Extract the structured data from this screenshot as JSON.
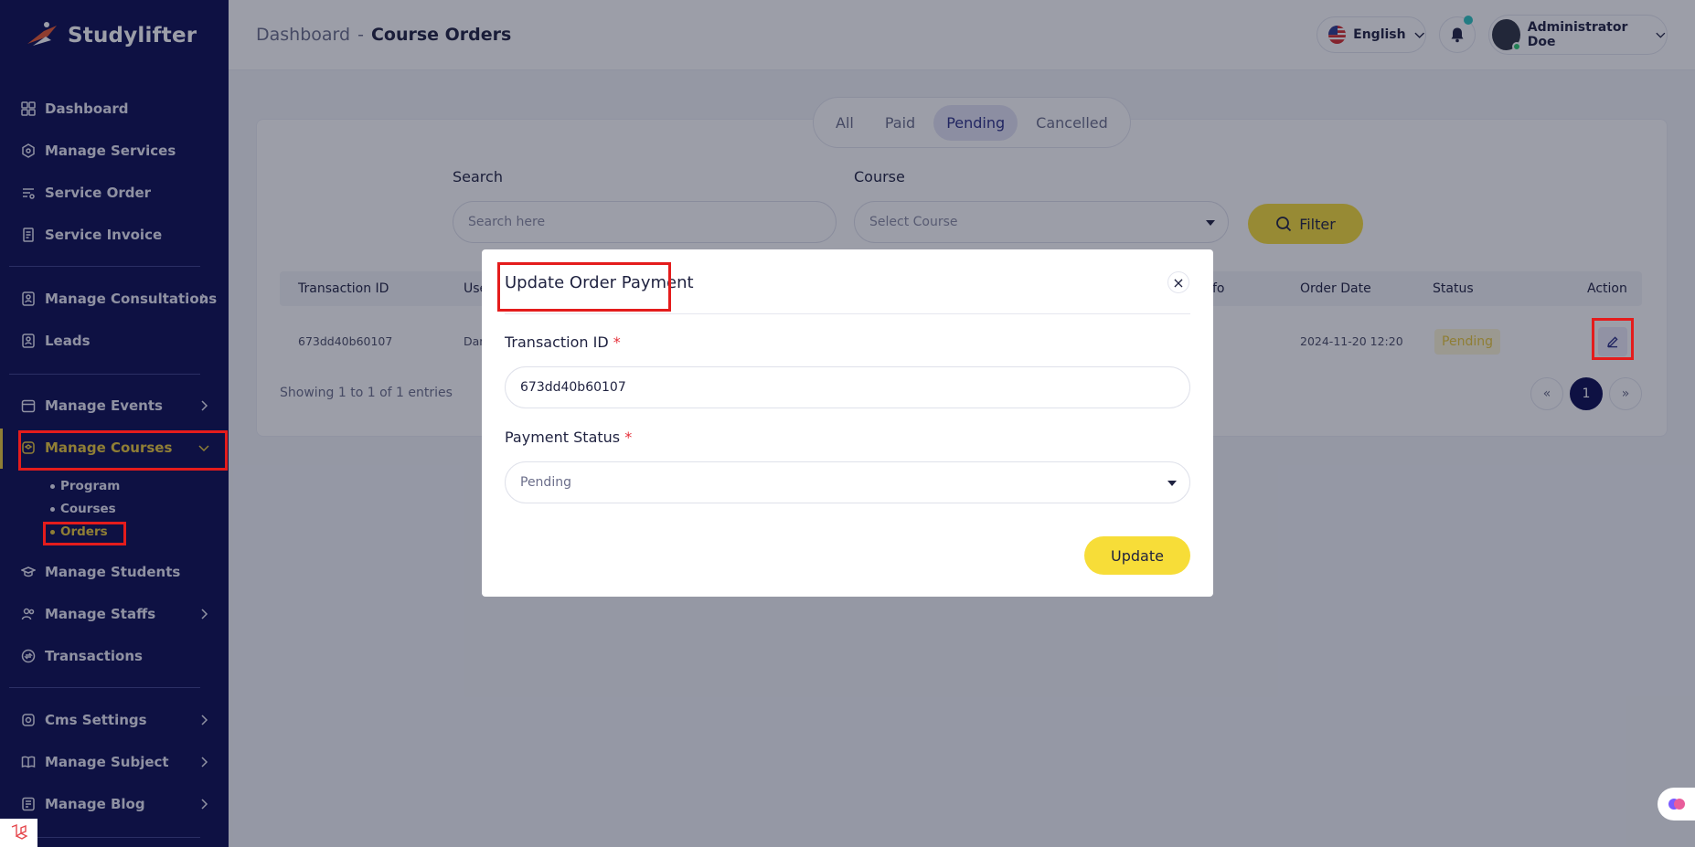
{
  "brand": {
    "name": "Studylifter"
  },
  "sidebar": {
    "items": [
      {
        "label": "Dashboard",
        "icon": "dashboard-icon"
      },
      {
        "label": "Manage Services",
        "icon": "services-icon"
      },
      {
        "label": "Service Order",
        "icon": "service-order-icon"
      },
      {
        "label": "Service Invoice",
        "icon": "invoice-icon"
      },
      {
        "label": "Manage Consultations",
        "icon": "consultations-icon"
      },
      {
        "label": "Leads",
        "icon": "leads-icon"
      },
      {
        "label": "Manage Events",
        "icon": "calendar-icon"
      },
      {
        "label": "Manage Courses",
        "icon": "courses-icon"
      },
      {
        "label": "Manage Students",
        "icon": "students-icon"
      },
      {
        "label": "Manage Staffs",
        "icon": "staffs-icon"
      },
      {
        "label": "Transactions",
        "icon": "transactions-icon"
      },
      {
        "label": "Cms Settings",
        "icon": "settings-icon"
      },
      {
        "label": "Manage Subject",
        "icon": "subject-icon"
      },
      {
        "label": "Manage Blog",
        "icon": "blog-icon"
      }
    ],
    "courses_sub": [
      "Program",
      "Courses",
      "Orders"
    ]
  },
  "header": {
    "breadcrumb_root": "Dashboard",
    "breadcrumb_sep": "-",
    "breadcrumb_current": "Course Orders",
    "language": "English",
    "user_name": "Administrator Doe"
  },
  "tabs": [
    "All",
    "Paid",
    "Pending",
    "Cancelled"
  ],
  "filters": {
    "search_label": "Search",
    "search_placeholder": "Search here",
    "course_label": "Course",
    "course_placeholder": "Select Course",
    "filter_button": "Filter"
  },
  "table": {
    "headers": {
      "transaction_id": "Transaction ID",
      "user": "Use",
      "info": "fo",
      "order_date": "Order Date",
      "status": "Status",
      "action": "Action"
    },
    "row": {
      "transaction_id": "673dd40b60107",
      "user": "Dar",
      "order_date": "2024-11-20 12:20",
      "status": "Pending"
    },
    "entries_text": "Showing 1 to 1 of 1 entries",
    "pagination": {
      "prev": "«",
      "current": "1",
      "next": "»"
    }
  },
  "modal": {
    "title": "Update Order Payment",
    "close": "×",
    "transaction_label": "Transaction ID",
    "transaction_value": "673dd40b60107",
    "status_label": "Payment Status",
    "status_value": "Pending",
    "required_mark": "*",
    "update_button": "Update"
  },
  "colors": {
    "sidebar_bg": "#0b0d52",
    "accent_yellow": "#f7dd38",
    "active_text": "#e9c93a",
    "annotation_red": "#e41c1c"
  }
}
